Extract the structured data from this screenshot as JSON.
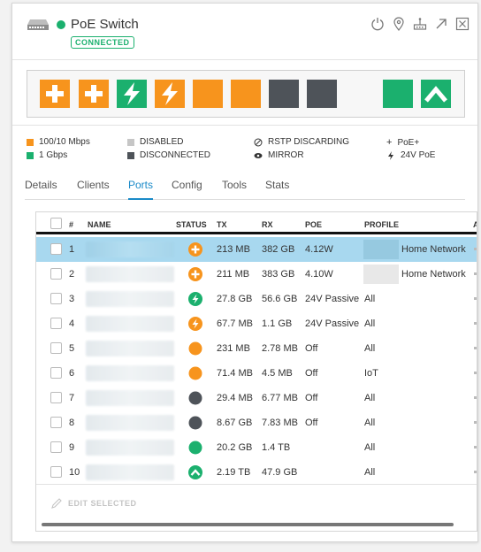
{
  "header": {
    "title": "PoE Switch",
    "status_badge": "CONNECTED",
    "icons": [
      "restart-icon",
      "locate-icon",
      "device-manage-icon",
      "open-external-icon",
      "close-icon"
    ]
  },
  "port_panel": {
    "ports": [
      {
        "type": "poe-plus",
        "color": "#f7941d"
      },
      {
        "type": "poe-plus",
        "color": "#f7941d"
      },
      {
        "type": "24v-poe",
        "color": "#1bb06e"
      },
      {
        "type": "24v-poe",
        "color": "#f7941d"
      },
      {
        "type": "plain",
        "color": "#f7941d"
      },
      {
        "type": "plain",
        "color": "#f7941d"
      },
      {
        "type": "disconnected",
        "color": "#4e5359"
      },
      {
        "type": "disconnected",
        "color": "#4e5359"
      },
      {
        "type": "plain",
        "color": "#1bb06e"
      },
      {
        "type": "uplink",
        "color": "#1bb06e"
      }
    ]
  },
  "legend": {
    "speed_100": "100/10 Mbps",
    "speed_1g": "1 Gbps",
    "disabled": "DISABLED",
    "disconnected": "DISCONNECTED",
    "rstp": "RSTP DISCARDING",
    "mirror": "MIRROR",
    "poe_plus": "PoE+",
    "poe_24v": "24V PoE",
    "colors": {
      "orange": "#f7941d",
      "green": "#1bb06e",
      "gray": "#c6c6c6",
      "dark": "#4e5359"
    }
  },
  "tabs": [
    "Details",
    "Clients",
    "Ports",
    "Config",
    "Tools",
    "Stats"
  ],
  "active_tab": "Ports",
  "table": {
    "columns": [
      "#",
      "NAME",
      "STATUS",
      "TX",
      "RX",
      "POE",
      "PROFILE",
      "A"
    ],
    "rows": [
      {
        "num": "1",
        "status": "poe-plus-orange",
        "tx": "213 MB",
        "rx": "382 GB",
        "poe": "4.12W",
        "profile": "Home Network",
        "selected": true
      },
      {
        "num": "2",
        "status": "poe-plus-orange",
        "tx": "211 MB",
        "rx": "383 GB",
        "poe": "4.10W",
        "profile": "Home Network",
        "selected": false
      },
      {
        "num": "3",
        "status": "24v-green",
        "tx": "27.8 GB",
        "rx": "56.6 GB",
        "poe": "24V Passive",
        "profile": "All",
        "selected": false
      },
      {
        "num": "4",
        "status": "24v-orange",
        "tx": "67.7 MB",
        "rx": "1.1 GB",
        "poe": "24V Passive",
        "profile": "All",
        "selected": false
      },
      {
        "num": "5",
        "status": "orange-dot",
        "tx": "231 MB",
        "rx": "2.78 MB",
        "poe": "Off",
        "profile": "All",
        "selected": false
      },
      {
        "num": "6",
        "status": "orange-dot",
        "tx": "71.4 MB",
        "rx": "4.5 MB",
        "poe": "Off",
        "profile": "IoT",
        "selected": false
      },
      {
        "num": "7",
        "status": "dark-dot",
        "tx": "29.4 MB",
        "rx": "6.77 MB",
        "poe": "Off",
        "profile": "All",
        "selected": false
      },
      {
        "num": "8",
        "status": "dark-dot",
        "tx": "8.67 GB",
        "rx": "7.83 MB",
        "poe": "Off",
        "profile": "All",
        "selected": false
      },
      {
        "num": "9",
        "status": "green-dot",
        "tx": "20.2 GB",
        "rx": "1.4 TB",
        "poe": "",
        "profile": "All",
        "selected": false
      },
      {
        "num": "10",
        "status": "uplink-green",
        "tx": "2.19 TB",
        "rx": "47.9 GB",
        "poe": "",
        "profile": "All",
        "selected": false
      }
    ]
  },
  "edit_selected_label": "EDIT SELECTED"
}
